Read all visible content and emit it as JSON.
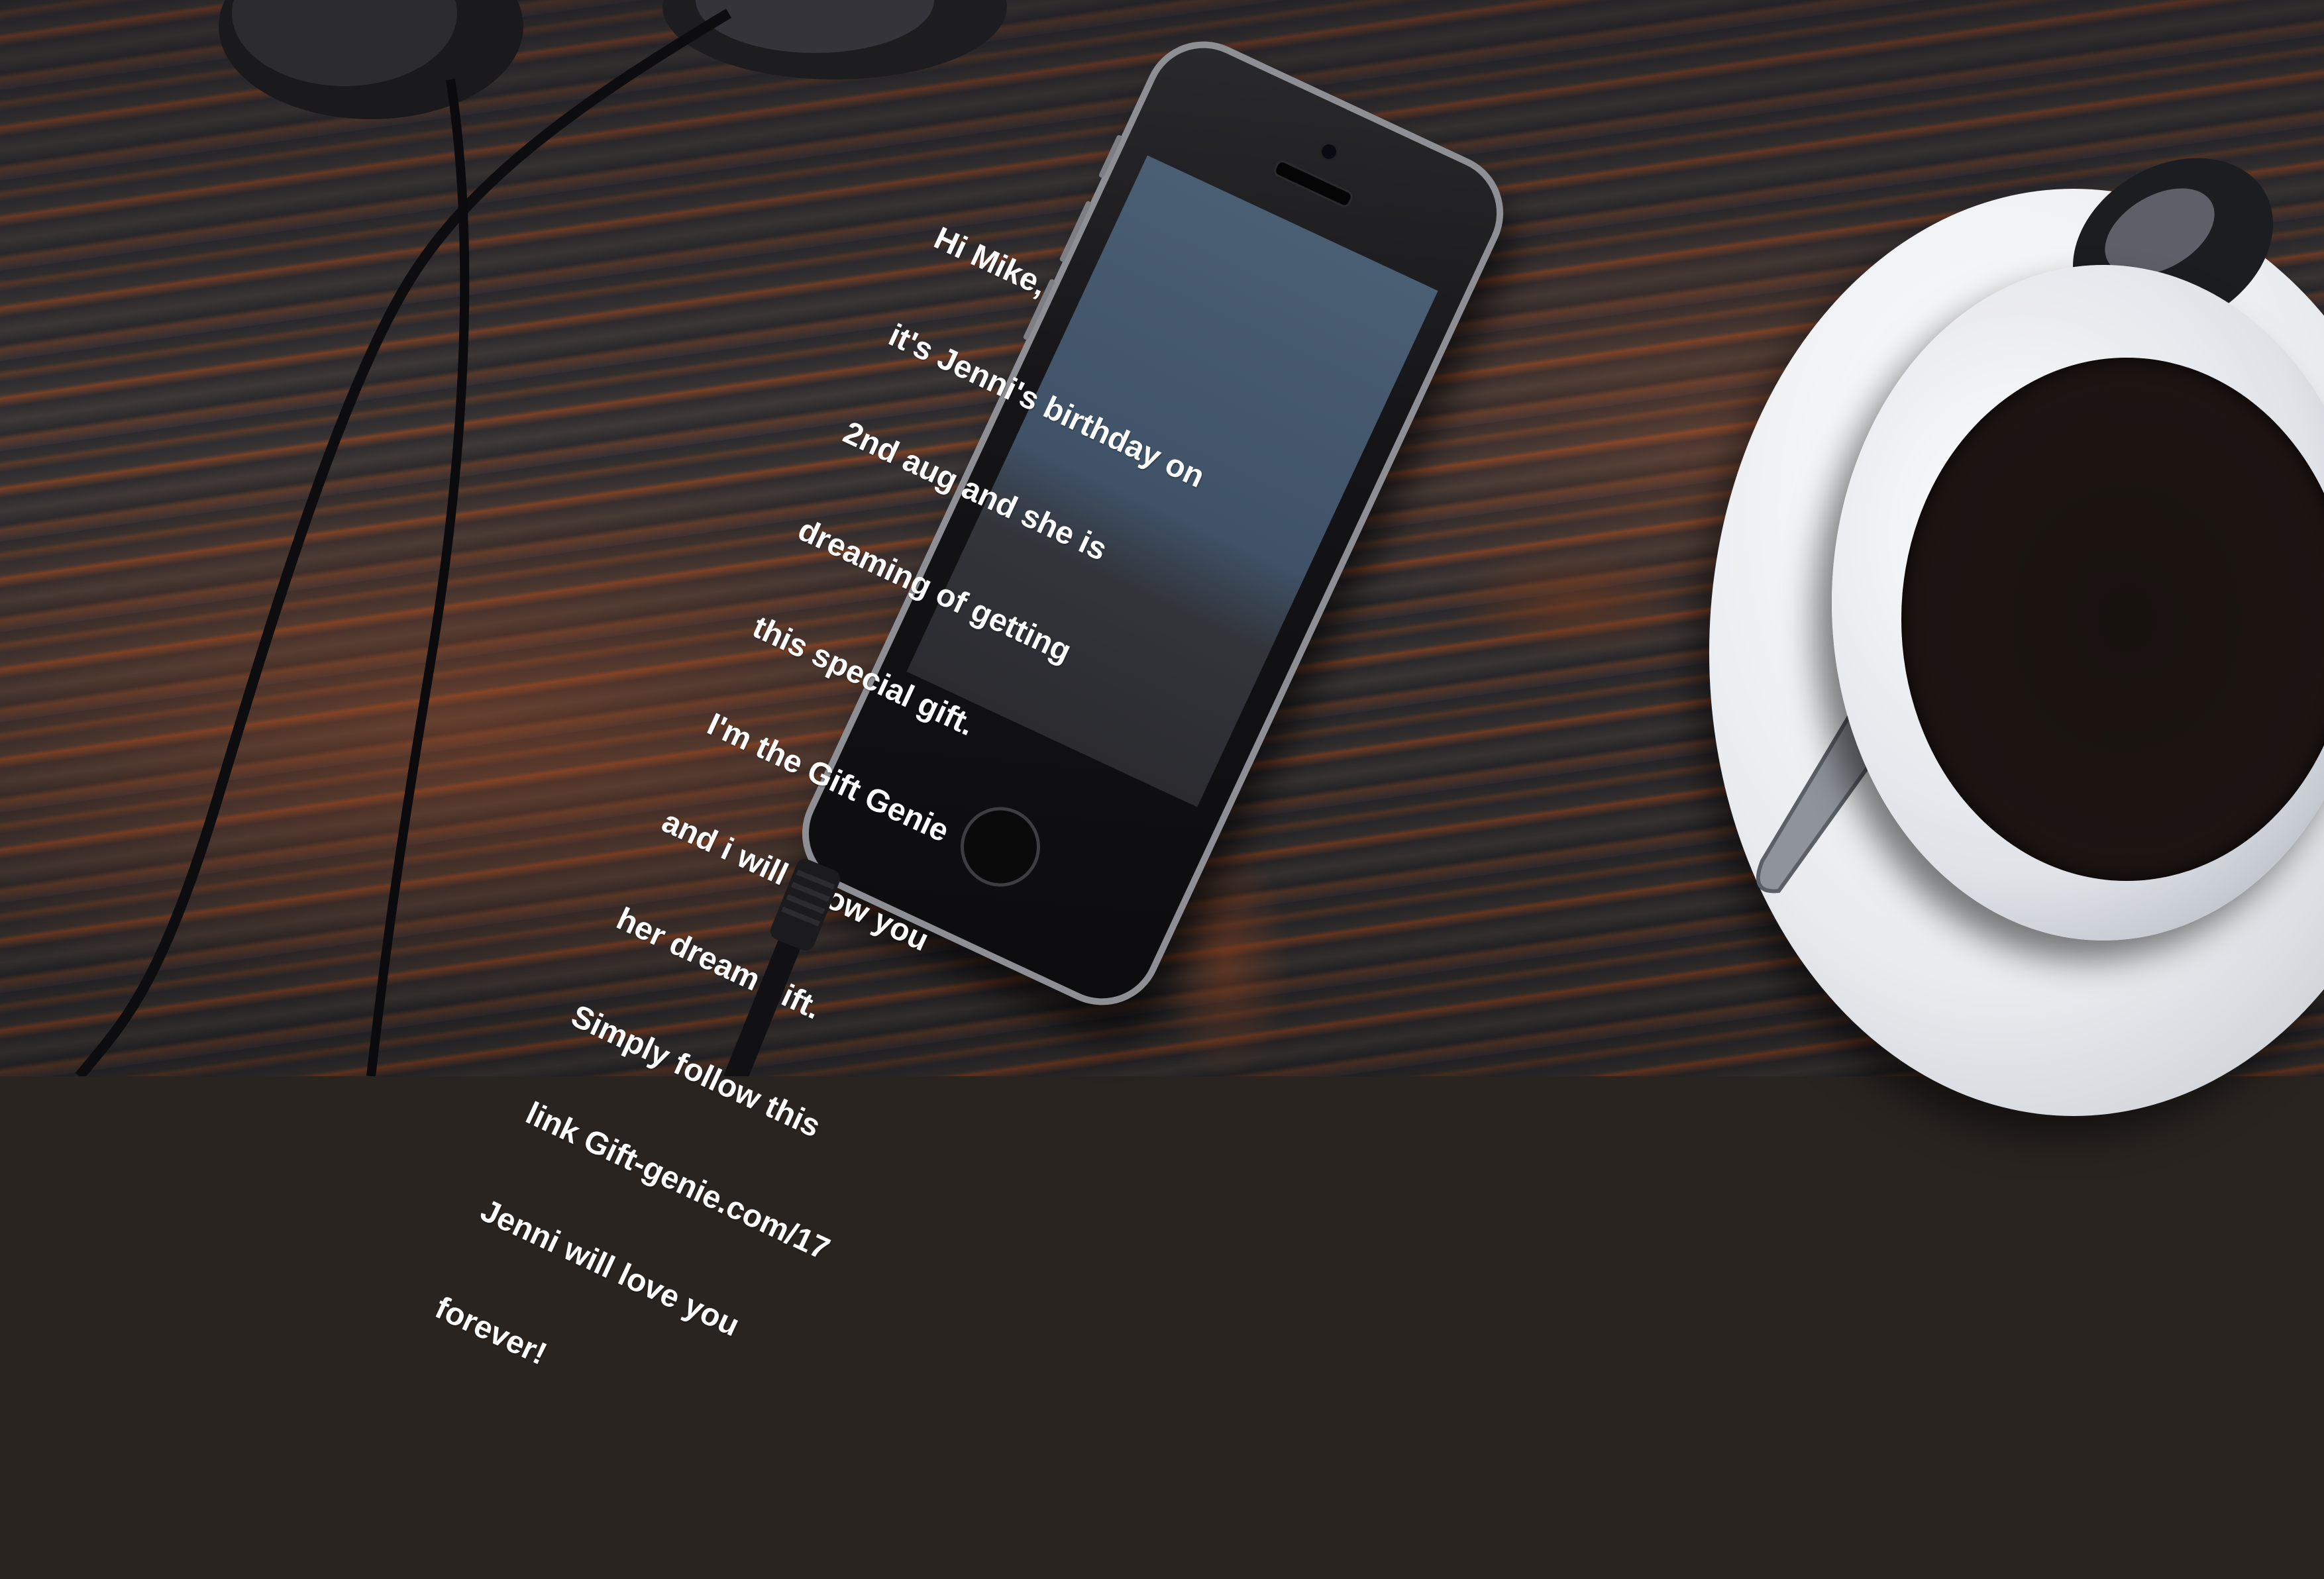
{
  "message": {
    "lines": [
      "Hi Mike,",
      "it's Jenni's birthday on",
      "2nd aug and she is",
      "dreaming of getting",
      "this special gift.",
      "I'm the Gift Genie",
      "and i will show you",
      "her dream gift.",
      "Simply follow this",
      "link Gift-genie.com/17",
      "Jenni will love you",
      "forever!"
    ]
  },
  "colors": {
    "wood_dark": "#2e2c30",
    "wood_orange": "#7a4127",
    "screen_blue": "#4a5e74",
    "phone_frame": "#8d8f95",
    "coffee": "#1d1512",
    "cup": "#f2f4f6"
  }
}
